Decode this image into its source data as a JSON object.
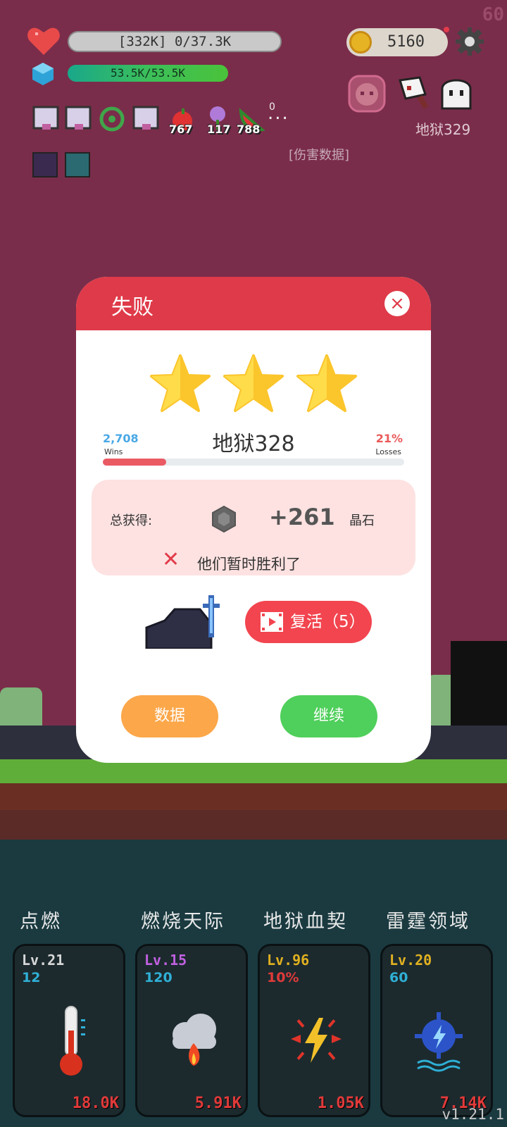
{
  "hud": {
    "fps": "60",
    "hp_text": "[332K] 0/37.3K",
    "mp_text": "53.5K/53.5K",
    "coins": "5160",
    "stage": "地狱329",
    "damage_link": "[伤害数据]",
    "buff_counts": [
      "767",
      "117",
      "788"
    ],
    "buff_zero": "0",
    "more": "..."
  },
  "dialog": {
    "title": "失败",
    "close": "×",
    "stars": 3,
    "stage_name": "地狱328",
    "wins_value": "2,708",
    "wins_label": "Wins",
    "losses_value": "21%",
    "losses_label": "Losses",
    "progress_fraction": 0.21,
    "reward_label": "总获得:",
    "reward_amount": "+261",
    "reward_unit": "晶石",
    "result_message": "他们暂时胜利了",
    "revive_label": "复活（5）",
    "data_button": "数据",
    "continue_button": "继续"
  },
  "skills": [
    {
      "name": "点燃",
      "level": "Lv.21",
      "value": "12",
      "cost": "18.0K",
      "level_color": "#d8d8d8"
    },
    {
      "name": "燃烧天际",
      "level": "Lv.15",
      "value": "120",
      "cost": "5.91K",
      "level_color": "#c060e0"
    },
    {
      "name": "地狱血契",
      "level": "Lv.96",
      "value": "10%",
      "cost": "1.05K",
      "level_color": "#e0b020"
    },
    {
      "name": "雷霆领域",
      "level": "Lv.20",
      "value": "60",
      "cost": "7.14K",
      "level_color": "#e0b020"
    }
  ],
  "skill_value_colors": [
    "#2fb0d6",
    "#2fb0d6",
    "#e03a3a",
    "#2fb0d6"
  ],
  "version": "v1.21.1",
  "colors": {
    "background": "#7a2d4a",
    "dialog_header": "#df3a49",
    "revive": "#f2454f",
    "data_button": "#fba74a",
    "continue_button": "#4fcf5b"
  }
}
